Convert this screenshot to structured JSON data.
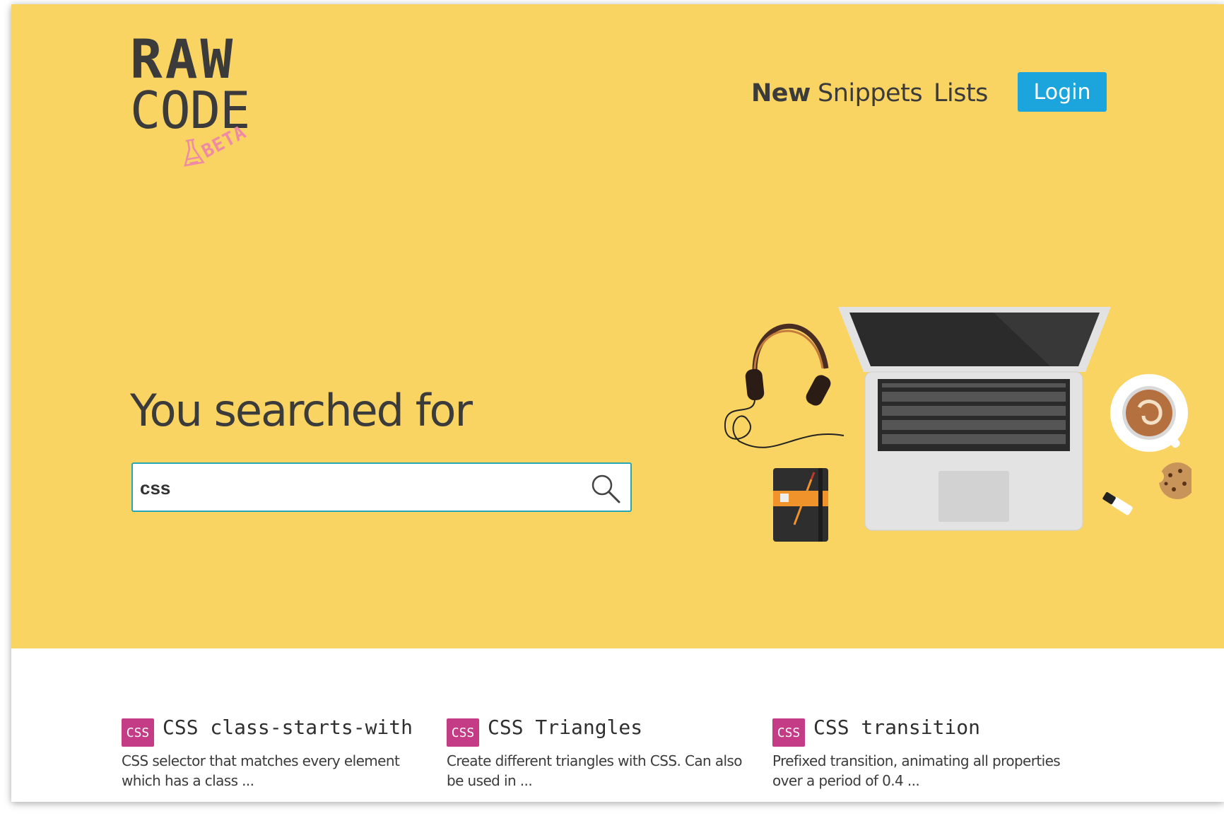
{
  "logo": {
    "line1": "RAW",
    "line2": "CODE",
    "badge": "BETA"
  },
  "nav": {
    "items": [
      "New",
      "Snippets",
      "Lists"
    ],
    "login_label": "Login"
  },
  "hero": {
    "heading": "You searched for"
  },
  "search": {
    "value": "css",
    "icon": "search-icon"
  },
  "colors": {
    "hero_bg": "#f9d462",
    "login_bg": "#1ba5dc",
    "tag_bg": "#c43c85",
    "search_border": "#27a7b4"
  },
  "results": [
    {
      "tag": "CSS",
      "title": "CSS class-starts-with",
      "desc": "CSS selector that matches every element which has a class ..."
    },
    {
      "tag": "CSS",
      "title": "CSS Triangles",
      "desc": "Create different triangles with CSS. Can also be used in ..."
    },
    {
      "tag": "CSS",
      "title": "CSS transition",
      "desc": "Prefixed transition, animating all properties over a period of 0.4 ..."
    }
  ]
}
